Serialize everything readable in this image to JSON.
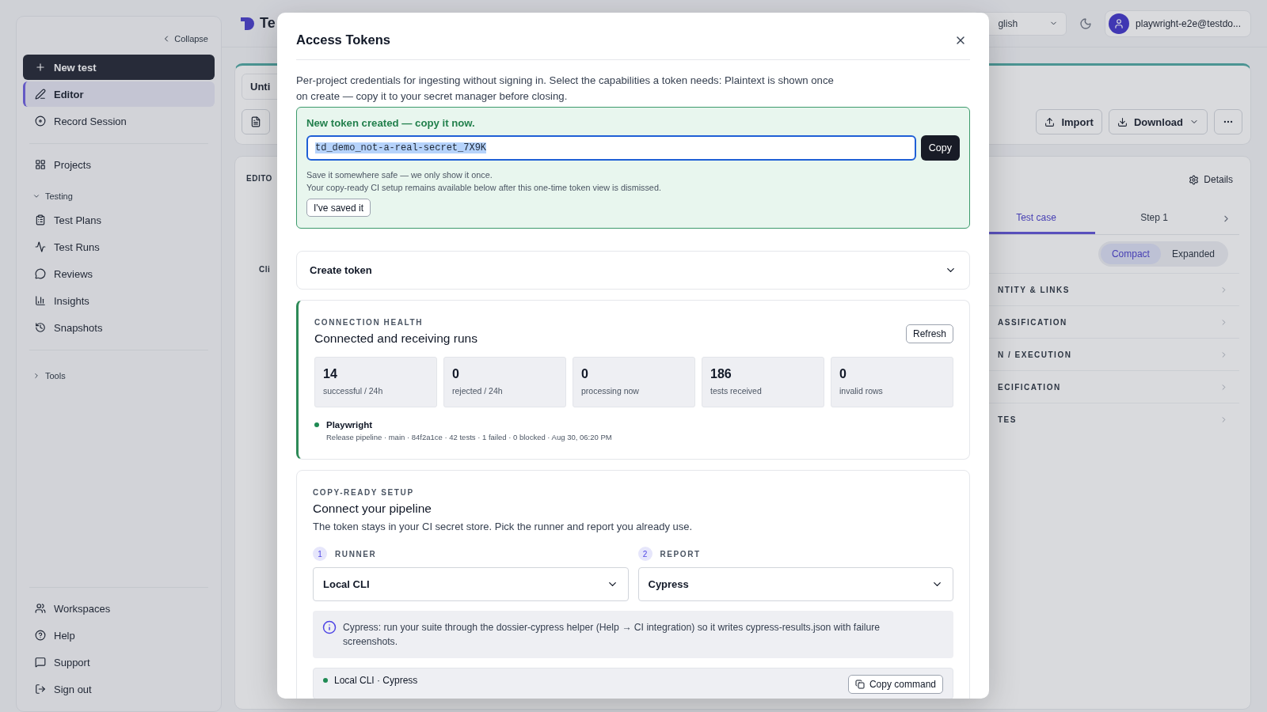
{
  "sidebar": {
    "collapse_label": "Collapse",
    "sections": [
      {
        "items": [
          {
            "label": "New test",
            "kind": "button",
            "selected": false
          },
          {
            "label": "Editor",
            "kind": "link",
            "selected": true
          },
          {
            "label": "Record Session",
            "kind": "link",
            "selected": false
          }
        ]
      },
      {
        "items": [
          {
            "label": "Projects",
            "kind": "link",
            "selected": false
          }
        ]
      },
      {
        "heading": "Testing",
        "expanded": true,
        "items": [
          {
            "label": "Test Plans",
            "kind": "link",
            "selected": false
          },
          {
            "label": "Test Runs",
            "kind": "link",
            "selected": false
          },
          {
            "label": "Reviews",
            "kind": "link",
            "selected": false
          },
          {
            "label": "Insights",
            "kind": "link",
            "selected": false
          },
          {
            "label": "Snapshots",
            "kind": "link",
            "selected": false
          }
        ]
      },
      {
        "heading": "Tools",
        "expanded": false
      }
    ],
    "footer": [
      {
        "label": "Workspaces"
      },
      {
        "label": "Help"
      },
      {
        "label": "Support"
      },
      {
        "label": "Sign out"
      }
    ]
  },
  "header": {
    "app_name": "Te",
    "language": "glish",
    "user": "playwright-e2e@testdo..."
  },
  "workspace": {
    "tab": "Unti",
    "toolbar": [
      {
        "label": "Import",
        "menu": false
      },
      {
        "label": "Download",
        "menu": true
      }
    ],
    "editor_label": "EDITO",
    "editor_hint": "Cli",
    "details": "Details",
    "tabs": [
      {
        "label": "Test case",
        "selected": true
      },
      {
        "label": "Step 1",
        "selected": false
      }
    ],
    "view": [
      {
        "label": "Compact",
        "selected": true
      },
      {
        "label": "Expanded",
        "selected": false
      }
    ],
    "sections": [
      "NTITY & LINKS",
      "ASSIFICATION",
      "N / EXECUTION",
      "ECIFICATION",
      "TES"
    ]
  },
  "dialog": {
    "title": "Access Tokens",
    "description": "Per-project credentials for ingesting without signing in. Select the capabilities a token needs: Plaintext is shown once on create — copy it to your secret manager before closing.",
    "new_token": {
      "title": "New token created — copy it now.",
      "value": "td_demo_not-a-real-secret_7X9K",
      "copy": "Copy",
      "notes": [
        "Save it somewhere safe — we only show it once.",
        "Your copy-ready CI setup remains available below after this one-time token view is dismissed."
      ],
      "dismiss": "I've saved it"
    },
    "create_token": {
      "label": "Create token",
      "expanded": false
    },
    "health": {
      "eyebrow": "CONNECTION HEALTH",
      "title": "Connected and receiving runs",
      "refresh": "Refresh",
      "stats": [
        {
          "value": "14",
          "label": "successful / 24h"
        },
        {
          "value": "0",
          "label": "rejected / 24h"
        },
        {
          "value": "0",
          "label": "processing now"
        },
        {
          "value": "186",
          "label": "tests received"
        },
        {
          "value": "0",
          "label": "invalid rows"
        }
      ],
      "source": {
        "name": "Playwright",
        "color": "#1f8a53",
        "meta": "Release pipeline · main · 84f2a1ce · 42 tests · 1 failed · 0 blocked · Aug 30, 06:20 PM"
      }
    },
    "setup": {
      "eyebrow": "COPY-READY SETUP",
      "title": "Connect your pipeline",
      "description": "The token stays in your CI secret store. Pick the runner and report you already use.",
      "steps": [
        {
          "number": "1",
          "label": "RUNNER",
          "value": "Local CLI"
        },
        {
          "number": "2",
          "label": "REPORT",
          "value": "Cypress"
        }
      ],
      "info": "Cypress: run your suite through the dossier-cypress helper (Help → CI integration) so it writes cypress-results.json with failure screenshots.",
      "command": {
        "title": "Local CLI · Cypress",
        "color": "#1f8a53",
        "button": "Copy command"
      }
    }
  }
}
